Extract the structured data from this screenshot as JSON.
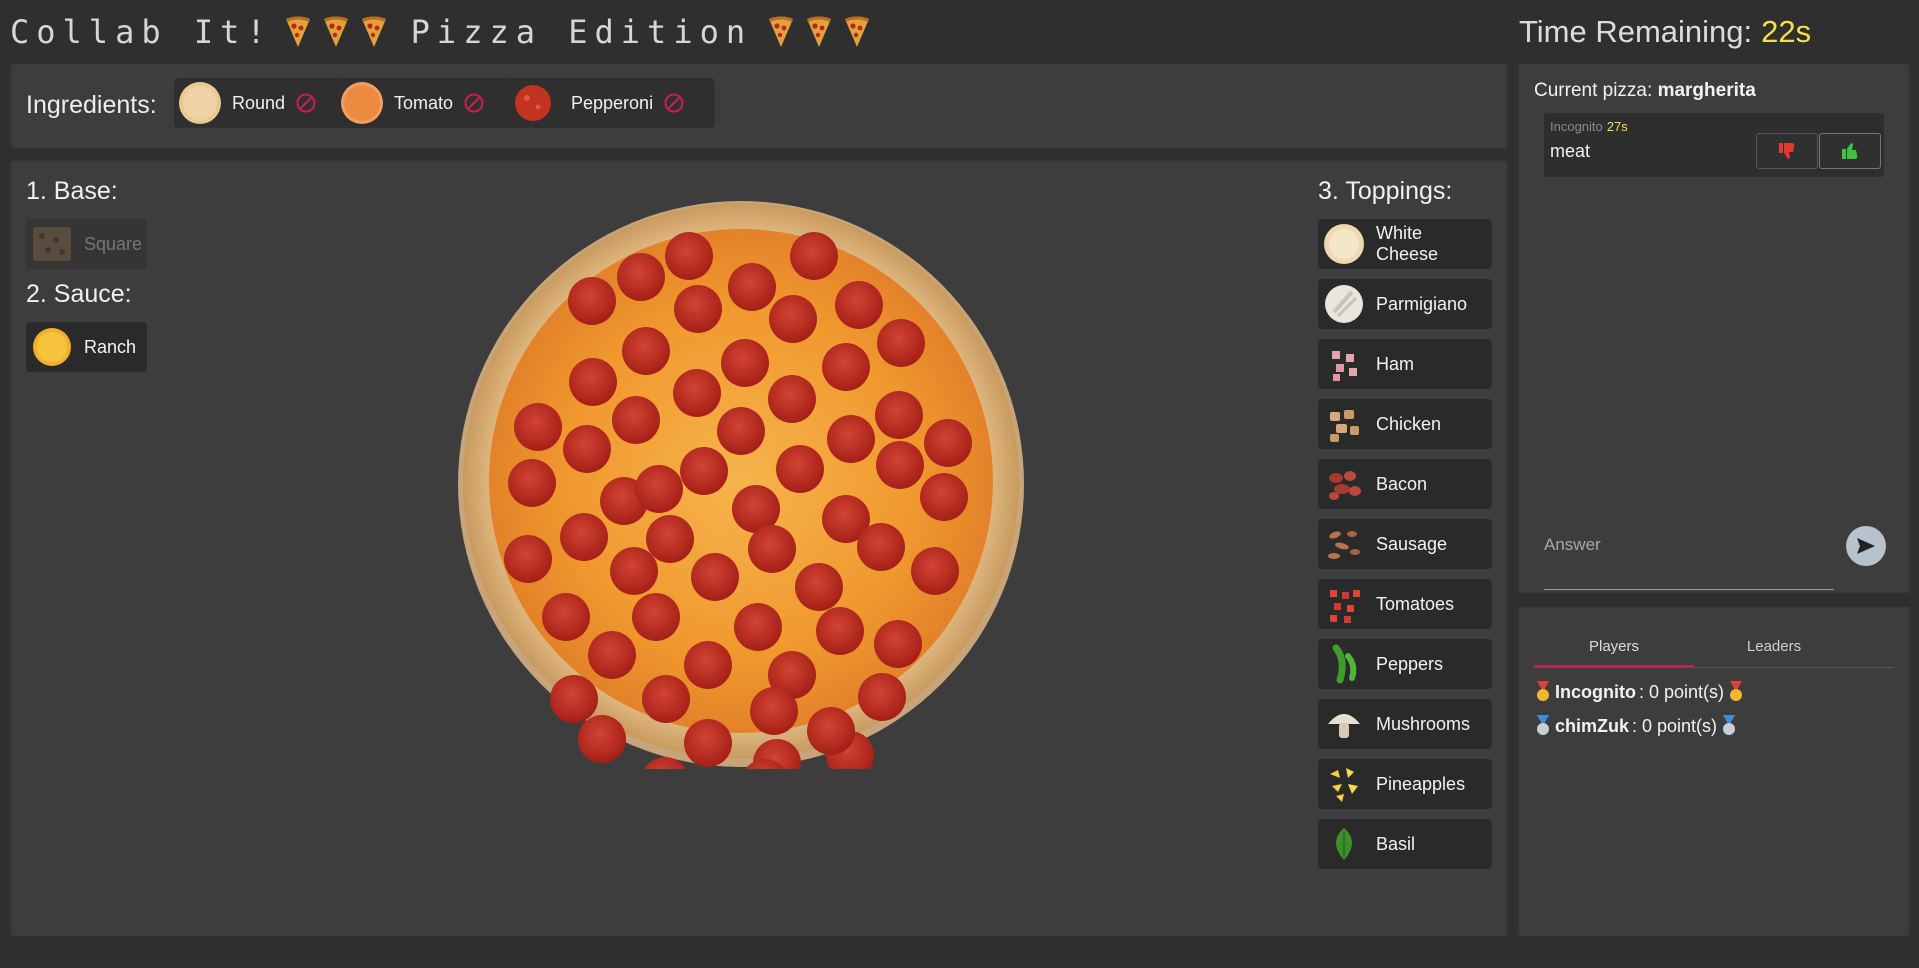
{
  "header": {
    "title_left": "Collab It!",
    "title_right": "Pizza Edition",
    "icons": [
      "pizza-slice-icon",
      "pizza-slice-icon",
      "pizza-slice-icon"
    ]
  },
  "timer": {
    "label": "Time Remaining:",
    "value": "22s",
    "accent": "#f4e04d"
  },
  "ingredients_bar": {
    "label": "Ingredients:",
    "items": [
      {
        "name": "Round"
      },
      {
        "name": "Tomato"
      },
      {
        "name": "Pepperoni"
      }
    ],
    "remove_color": "#c81e50"
  },
  "sections": {
    "base": {
      "title": "1. Base:",
      "items": [
        {
          "name": "Square"
        }
      ]
    },
    "sauce": {
      "title": "2. Sauce:",
      "items": [
        {
          "name": "Ranch"
        }
      ]
    },
    "toppings": {
      "title": "3. Toppings:",
      "items": [
        {
          "name": "White Cheese"
        },
        {
          "name": "Parmigiano"
        },
        {
          "name": "Ham"
        },
        {
          "name": "Chicken"
        },
        {
          "name": "Bacon"
        },
        {
          "name": "Sausage"
        },
        {
          "name": "Tomatoes"
        },
        {
          "name": "Peppers"
        },
        {
          "name": "Mushrooms"
        },
        {
          "name": "Pineapples"
        },
        {
          "name": "Basil"
        }
      ]
    }
  },
  "chat": {
    "current_label": "Current pizza:",
    "current_value": "margherita",
    "messages": [
      {
        "user": "Incognito",
        "time": "27s",
        "text": "meat"
      }
    ],
    "answer_placeholder": "Answer"
  },
  "scoreboard": {
    "tabs": [
      {
        "label": "Players",
        "active": true
      },
      {
        "label": "Leaders",
        "active": false
      }
    ],
    "players": [
      {
        "name": "Incognito",
        "score": ": 0 point(s)",
        "medal": "gold-medal-icon"
      },
      {
        "name": "chimZuk",
        "score": ": 0 point(s)",
        "medal": "silver-medal-icon"
      }
    ]
  },
  "colors": {
    "background": "#2f2f2f",
    "panel": "#3d3d3d",
    "thumb_down": "#e03a2e",
    "thumb_up": "#3fc43f",
    "tab_underline": "#b0265a"
  }
}
